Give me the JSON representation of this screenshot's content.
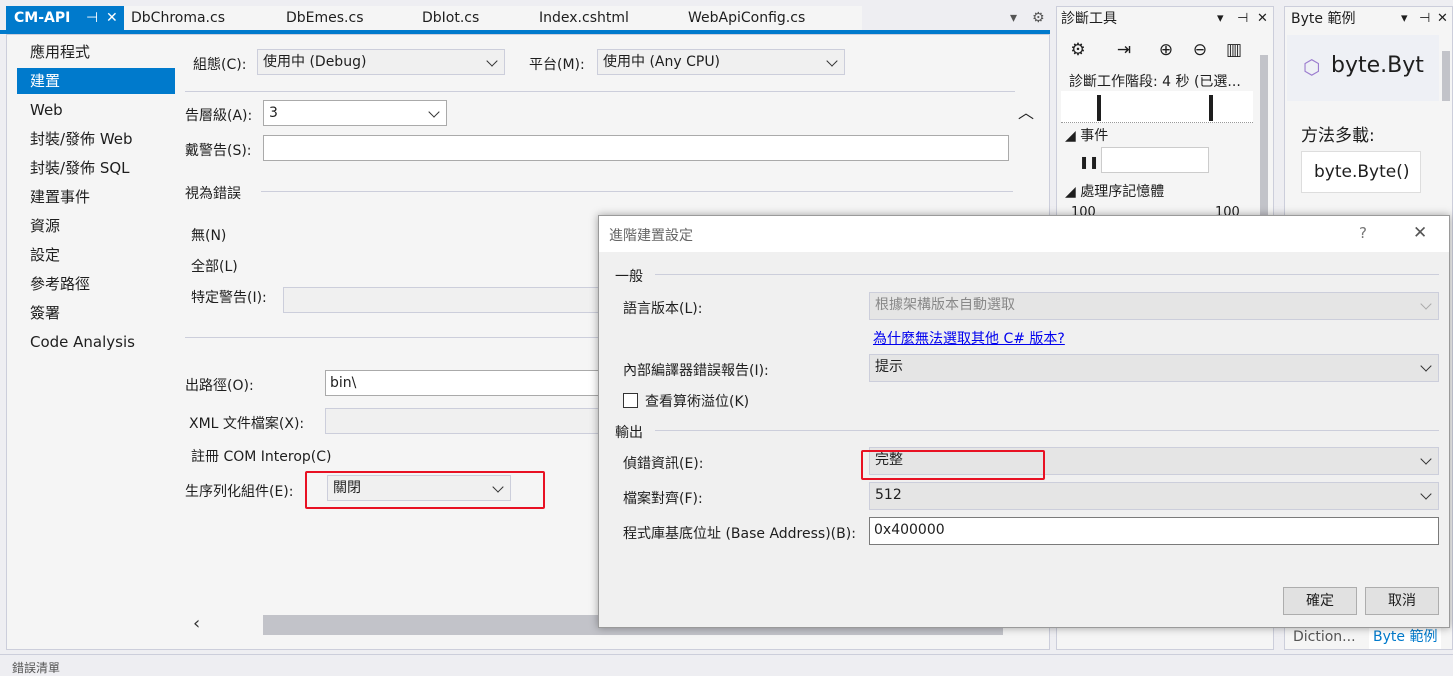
{
  "tabs": {
    "active": {
      "label": "CM-API",
      "pin": "⊣",
      "close": "✕"
    },
    "others": [
      "DbChroma.cs",
      "DbEmes.cs",
      "DbIot.cs",
      "Index.cshtml",
      "WebApiConfig.cs"
    ],
    "overflow": "▾",
    "gear": "⚙"
  },
  "nav": {
    "items": [
      "應用程式",
      "建置",
      "Web",
      "封裝/發佈 Web",
      "封裝/發佈 SQL",
      "建置事件",
      "資源",
      "設定",
      "參考路徑",
      "簽署",
      "Code Analysis"
    ],
    "active_index": 1
  },
  "build": {
    "config_label": "組態(C):",
    "config_value": "使用中 (Debug)",
    "platform_label": "平台(M):",
    "platform_value": "使用中 (Any CPU)",
    "warning_level_label": "告層級(A):",
    "warning_level_value": "3",
    "suppress_warnings_label": "戴警告(S):",
    "suppress_warnings_value": "",
    "treat_errors_section": "視為錯誤",
    "radio_none": "無(N)",
    "radio_all": "全部(L)",
    "radio_specific": "特定警告(I):",
    "output_path_label": "出路徑(O):",
    "output_path_value": "bin\\",
    "xml_doc_label": "XML 文件檔案(X):",
    "com_interop_label": "註冊 COM Interop(C)",
    "serialization_label": "生序列化組件(E):",
    "serialization_value": "關閉",
    "collapse": "︿",
    "scroll_left": "‹",
    "scroll_right": "›"
  },
  "diag": {
    "title": "診斷工具",
    "session": "診斷工作階段: 4 秒 (已選...",
    "events": "◢ 事件",
    "memory": "◢ 處理序記憶體",
    "mem_left": "100",
    "mem_right": "100",
    "pause": "❚❚",
    "controls": {
      "dropdown": "▾",
      "pin": "⊣",
      "close": "✕"
    },
    "toolbar_icons": [
      "gear-icon",
      "export-icon",
      "zoom-in-icon",
      "zoom-out-icon",
      "chart-icon"
    ]
  },
  "byte": {
    "title": "Byte 範例",
    "heading": "byte.Byt",
    "overloads_label": "方法多載:",
    "overload_item": "byte.Byte()",
    "bottom_tab_1": "Diction...",
    "bottom_tab_2": "Byte 範例",
    "controls": {
      "dropdown": "▾",
      "pin": "⊣",
      "close": "✕"
    }
  },
  "dialog": {
    "title": "進階建置設定",
    "help": "?",
    "close": "✕",
    "general_header": "一般",
    "lang_version_label": "語言版本(L):",
    "lang_version_value": "根據架構版本自動選取",
    "why_link": "為什麼無法選取其他 C# 版本?",
    "error_report_label": "內部編譯器錯誤報告(I):",
    "error_report_value": "提示",
    "overflow_label": "查看算術溢位(K)",
    "output_header": "輸出",
    "debug_info_label": "偵錯資訊(E):",
    "debug_info_value": "完整",
    "file_align_label": "檔案對齊(F):",
    "file_align_value": "512",
    "base_address_label": "程式庫基底位址 (Base Address)(B):",
    "base_address_value": "0x400000",
    "ok": "確定",
    "cancel": "取消"
  },
  "bottom": {
    "title": "錯誤清單"
  },
  "colors": {
    "accent": "#007acc",
    "highlight": "#e81123"
  }
}
